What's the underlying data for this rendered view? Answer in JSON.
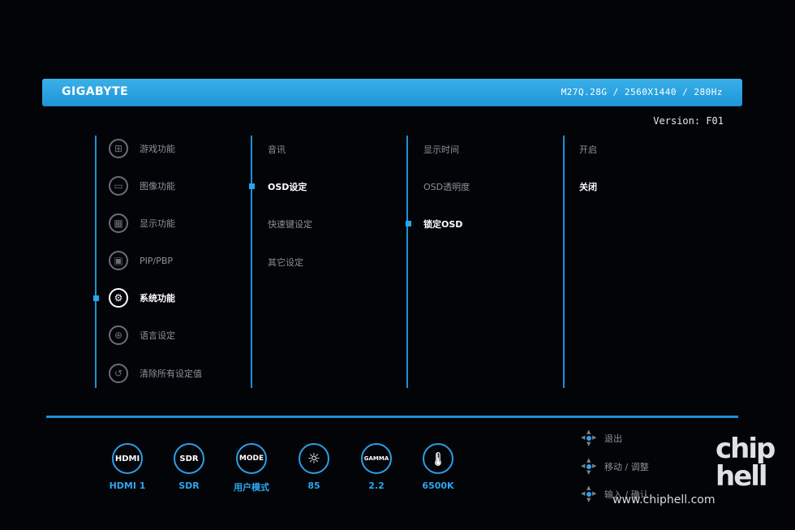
{
  "header": {
    "brand": "GIGABYTE",
    "model_info": "M27Q.28G / 2560X1440 / 280Hz"
  },
  "version": "Version: F01",
  "main_menu": [
    {
      "label": "游戏功能",
      "icon": "gamepad-icon"
    },
    {
      "label": "图像功能",
      "icon": "picture-icon"
    },
    {
      "label": "显示功能",
      "icon": "display-grid-icon"
    },
    {
      "label": "PIP/PBP",
      "icon": "pip-icon"
    },
    {
      "label": "系统功能",
      "icon": "gear-icon",
      "active": true
    },
    {
      "label": "语言设定",
      "icon": "globe-icon"
    },
    {
      "label": "清除所有设定值",
      "icon": "reset-icon"
    }
  ],
  "submenu": [
    "音讯",
    "OSD设定",
    "快速键设定",
    "其它设定"
  ],
  "osd_options": [
    "显示时间",
    "OSD透明度",
    "锁定OSD"
  ],
  "lock_options": [
    "开启",
    "关闭"
  ],
  "status_bar": [
    {
      "icon_text": "HDMI",
      "label": "HDMI 1"
    },
    {
      "icon_text": "SDR",
      "label": "SDR"
    },
    {
      "icon_text": "MODE",
      "label": "用户模式"
    },
    {
      "icon_text": "☼",
      "label": "85"
    },
    {
      "icon_text": "GAMMA",
      "label": "2.2"
    },
    {
      "icon_text": "🌡",
      "label": "6500K"
    }
  ],
  "nav_hints": [
    "退出",
    "移动 / 调整",
    "输入 / 确认"
  ],
  "watermark": "www.chiphell.com",
  "logo_text": "chip hell",
  "colors": {
    "accent": "#1d8fd8",
    "header": "#2aa6ef",
    "background": "#030408",
    "active_text": "#ffffff",
    "inactive_text": "#8d9197"
  }
}
